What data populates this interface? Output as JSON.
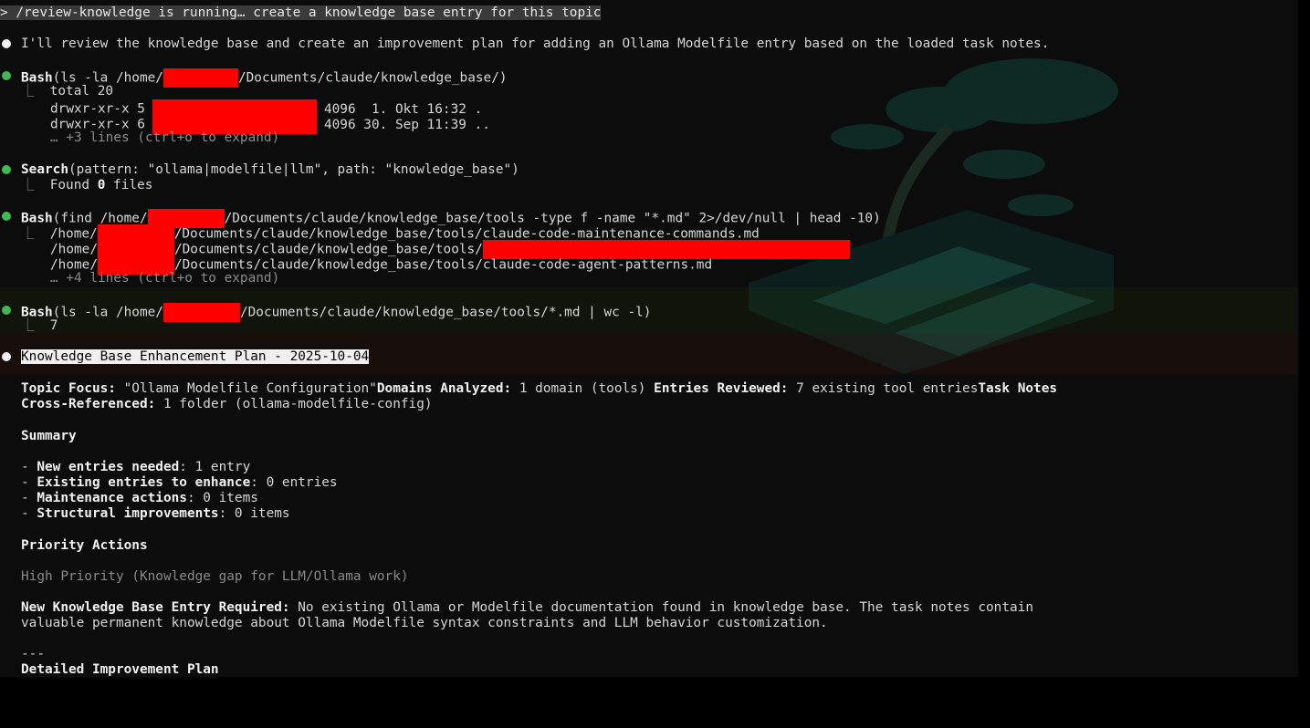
{
  "prompt": "> /review-knowledge is running… create a knowledge base entry for this topic",
  "intro": "I'll review the knowledge base and create an improvement plan for adding an Ollama Modelfile entry based on the loaded task notes.",
  "tools": [
    {
      "name": "Bash",
      "args_pre": "(ls -la /home/",
      "args_post": "/Documents/claude/knowledge_base/)",
      "output": [
        "total 20",
        "drwxr-xr-x 5",
        "4096  1. Okt 16:32 .",
        "drwxr-xr-x 6",
        "4096 30. Sep 11:39 ..",
        "… +3 lines (ctrl+o to expand)"
      ]
    },
    {
      "name": "Search",
      "args": "(pattern: \"ollama|modelfile|llm\", path: \"knowledge_base\")",
      "output_pre": "Found ",
      "output_count": "0",
      "output_post": " files"
    },
    {
      "name": "Bash",
      "args_pre": "(find /home/",
      "args_post": "/Documents/claude/knowledge_base/tools -type f -name \"*.md\" 2>/dev/null | head -10)",
      "output": [
        "/home/",
        "/Documents/claude/knowledge_base/tools/claude-code-maintenance-commands.md",
        "/Documents/claude/knowledge_base/tools/",
        "/Documents/claude/knowledge_base/tools/claude-code-agent-patterns.md",
        "… +4 lines (ctrl+o to expand)"
      ]
    },
    {
      "name": "Bash",
      "args_pre": "(ls -la /home/",
      "args_post": "/Documents/claude/knowledge_base/tools/*.md | wc -l)",
      "output": [
        "7"
      ]
    }
  ],
  "plan": {
    "heading": "Knowledge Base Enhancement Plan - 2025-10-04",
    "topic_label": "Topic Focus:",
    "topic_value": " \"Ollama Modelfile Configuration\"",
    "domains_label": "Domains Analyzed:",
    "domains_value": " 1 domain (tools)",
    "reviewed_label": "Entries Reviewed:",
    "reviewed_value": " 7 existing tool entries",
    "task_label_1": "Task Notes",
    "task_label_2": "Cross-Referenced:",
    "task_value": " 1 folder (ollama-modelfile-config)",
    "summary_heading": "Summary",
    "summary": [
      {
        "label": "New entries needed",
        "value": ": 1 entry"
      },
      {
        "label": "Existing entries to enhance",
        "value": ": 0 entries"
      },
      {
        "label": "Maintenance actions",
        "value": ": 0 items"
      },
      {
        "label": "Structural improvements",
        "value": ": 0 items"
      }
    ],
    "priority_heading": "Priority Actions",
    "high_priority": "High Priority (Knowledge gap for LLM/Ollama work)",
    "new_entry_label": "New Knowledge Base Entry Required:",
    "new_entry_text_1": " No existing Ollama or Modelfile documentation found in knowledge base. The task notes contain",
    "new_entry_text_2": "valuable permanent knowledge about Ollama Modelfile syntax constraints and LLM behavior customization.",
    "separator": "---",
    "detailed_heading": "Detailed Improvement Plan"
  },
  "colors": {
    "bullet_green": "#3fb950",
    "redaction": "#ff0000"
  }
}
